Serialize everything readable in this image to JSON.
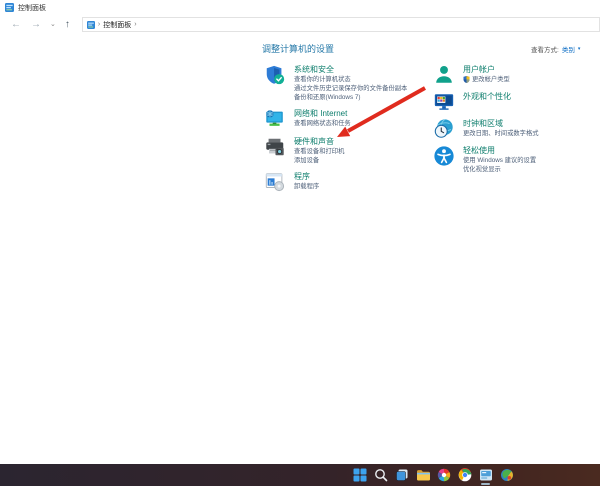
{
  "window": {
    "title": "控制面板",
    "breadcrumb": {
      "separator": "›",
      "root": "控制面板"
    },
    "nav": {
      "back": "←",
      "forward": "→",
      "dropdown": "⌄",
      "up": "↑"
    }
  },
  "header": {
    "heading": "调整计算机的设置",
    "view_by_label": "查看方式:",
    "view_by_value": "类别",
    "view_by_caret": "▾"
  },
  "categories": {
    "left": [
      {
        "id": "system-security",
        "icon": "shield",
        "title": "系统和安全",
        "links": [
          "查看你的计算机状态",
          "通过文件历史记录保存你的文件备份副本",
          "备份和还原(Windows 7)"
        ]
      },
      {
        "id": "network-internet",
        "icon": "network",
        "title": "网络和 Internet",
        "links": [
          "查看网络状态和任务"
        ]
      },
      {
        "id": "hardware-sound",
        "icon": "printer",
        "title": "硬件和声音",
        "links": [
          "查看设备和打印机",
          "添加设备"
        ]
      },
      {
        "id": "programs",
        "icon": "programs",
        "title": "程序",
        "links": [
          "卸载程序"
        ]
      }
    ],
    "right": [
      {
        "id": "user-accounts",
        "icon": "user",
        "title": "用户帐户",
        "links": [
          "更改帐户类型"
        ],
        "uac_links": [
          0
        ]
      },
      {
        "id": "appearance-personalization",
        "icon": "personalization",
        "title": "外观和个性化",
        "links": []
      },
      {
        "id": "clock-region",
        "icon": "clock",
        "title": "时钟和区域",
        "links": [
          "更改日期、时间或数字格式"
        ]
      },
      {
        "id": "ease-of-access",
        "icon": "ease",
        "title": "轻松使用",
        "links": [
          "使用 Windows 建议的设置",
          "优化视觉显示"
        ]
      }
    ]
  },
  "annotation": {
    "type": "red-arrow",
    "points_to": "hardware-sound",
    "color": "#e02b1e"
  },
  "taskbar": {
    "icons": [
      {
        "name": "start",
        "active": false
      },
      {
        "name": "search",
        "active": false
      },
      {
        "name": "task-view",
        "active": false
      },
      {
        "name": "file-explorer",
        "active": false
      },
      {
        "name": "color-wheel-app",
        "active": false
      },
      {
        "name": "chrome",
        "active": false
      },
      {
        "name": "control-panel",
        "active": true
      },
      {
        "name": "colorful-app",
        "active": false
      }
    ]
  },
  "colors": {
    "category_title": "#0e7e6d",
    "task_link": "#4d5f78",
    "heading": "#2679a8",
    "view_by_link": "#0b6cc4",
    "arrow_red": "#e02b1e"
  }
}
